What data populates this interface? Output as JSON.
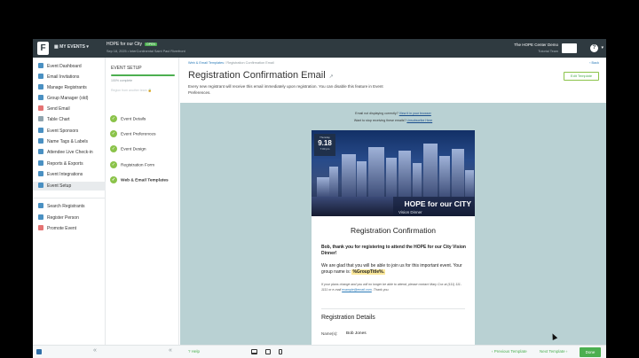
{
  "topbar": {
    "logo_letter": "F",
    "my_events": "MY EVENTS",
    "event_title": "HOPE for our City",
    "event_badge": "OPEN",
    "event_date": "Sep 18, 2025 • InterContinental Saint Paul Riverfront",
    "org_name": "The HOPE Center Demo",
    "org_sub": "Tutorial Team",
    "help_label": "?"
  },
  "nav": {
    "items": [
      {
        "label": "Event Dashboard",
        "color": "#4a90c2"
      },
      {
        "label": "Email Invitations",
        "color": "#4a90c2"
      },
      {
        "label": "Manage Registrants",
        "color": "#4a90c2"
      },
      {
        "label": "Group Manager (old)",
        "color": "#4a90c2"
      },
      {
        "label": "Send Email",
        "color": "#e57373"
      },
      {
        "label": "Table Chart",
        "color": "#90a4ae"
      },
      {
        "label": "Event Sponsors",
        "color": "#4a90c2"
      },
      {
        "label": "Name Tags & Labels",
        "color": "#4a90c2"
      },
      {
        "label": "Attendee Live Check-in",
        "color": "#4a90c2"
      },
      {
        "label": "Reports & Exports",
        "color": "#4a90c2"
      },
      {
        "label": "Event Integrations",
        "color": "#4a90c2"
      },
      {
        "label": "Event Setup",
        "color": "#4a90c2"
      },
      {
        "label": "Search Registrants",
        "color": "#4a90c2"
      },
      {
        "label": "Register Person",
        "color": "#4a90c2"
      },
      {
        "label": "Promote Event",
        "color": "#e57373"
      }
    ]
  },
  "setup": {
    "heading": "EVENT SETUP",
    "progress_label": "100% complete",
    "progress": 1.0,
    "reg_open": "Region from another team",
    "steps": [
      {
        "label": "Event Details"
      },
      {
        "label": "Event Preferences"
      },
      {
        "label": "Event Design"
      },
      {
        "label": "Registration Form"
      },
      {
        "label": "Web & Email Templates"
      }
    ]
  },
  "main": {
    "crumb_link": "Web & Email Templates",
    "crumb_sep": "/",
    "crumb_current": "Registration Confirmation Email",
    "back": "‹ Back",
    "title": "Registration Confirmation Email",
    "title_icon": "↗",
    "description": "Every new registrant will receive this email immediately upon registration. You can disable this feature in Event Preferences.",
    "edit_button": "Edit Template"
  },
  "preview": {
    "notice1_pre": "Email not displaying correctly? ",
    "notice1_link": "View it in your browser",
    "notice2_pre": "Want to stop receiving these emails? ",
    "notice2_link": "Unsubscribe Here",
    "hero": {
      "dow": "Thursday",
      "day": "9.18",
      "time": "7:00 pm",
      "title": "HOPE for our CITY",
      "subtitle": "Vision Dinner"
    },
    "heading": "Registration Confirmation",
    "thanks": "Bob, thank you for registering to attend the HOPE for our City Vision Dinner!",
    "glad_pre": "We are glad that you will be able to join us for this important event. Your group name is: ",
    "group_name": "%GroupTitle%.",
    "change_pre": "If your plans change and you will no longer be able to attend, please contact Mary Cox at (111) 111-1111 or e-mail ",
    "change_email": "example@email.com",
    "change_post": ". Thank you.",
    "details_heading": "Registration Details",
    "name_label": "Name(s):",
    "name_value": "Bob Jones"
  },
  "bottombar": {
    "chevron": "«",
    "help": "? Help",
    "prev": "‹ Previous Template",
    "next": "Next Template ›",
    "done": "Done"
  }
}
